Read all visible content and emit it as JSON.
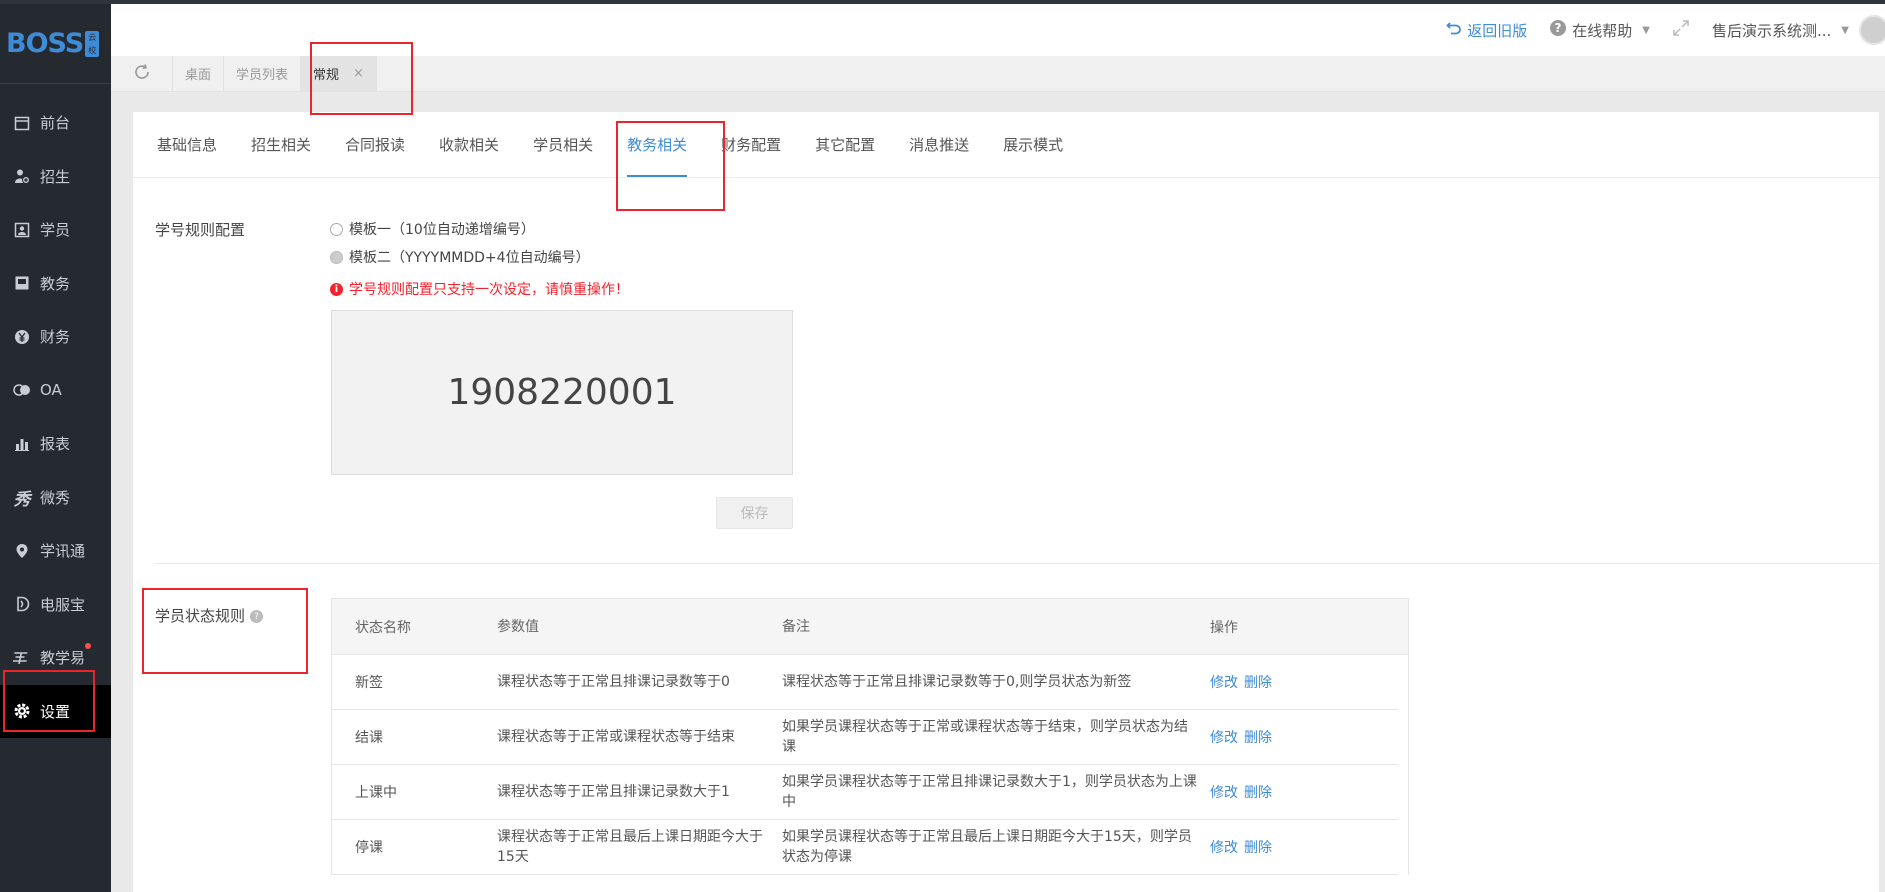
{
  "brand": {
    "logo_text": "BOSS",
    "logo_badge": [
      "云",
      "校"
    ]
  },
  "sidebar": {
    "items": [
      {
        "label": "前台",
        "icon": "calendar-icon"
      },
      {
        "label": "招生",
        "icon": "add-user-icon"
      },
      {
        "label": "学员",
        "icon": "id-card-icon"
      },
      {
        "label": "教务",
        "icon": "book-icon"
      },
      {
        "label": "财务",
        "icon": "yen-icon"
      },
      {
        "label": "OA",
        "icon": "toggle-icon"
      },
      {
        "label": "报表",
        "icon": "bar-chart-icon"
      },
      {
        "label": "微秀",
        "icon": "xiu-icon"
      },
      {
        "label": "学讯通",
        "icon": "location-icon"
      },
      {
        "label": "电服宝",
        "icon": "phone-icon"
      },
      {
        "label": "教学易",
        "icon": "teach-icon"
      },
      {
        "label": "设置",
        "icon": "gear-icon"
      }
    ],
    "active": "设置"
  },
  "header": {
    "back_label": "返回旧版",
    "help_label": "在线帮助",
    "user_label": "售后演示系统测..."
  },
  "tabbar": {
    "tabs": [
      {
        "label": "桌面"
      },
      {
        "label": "学员列表"
      },
      {
        "label": "常规"
      }
    ]
  },
  "subtabs": [
    "基础信息",
    "招生相关",
    "合同报读",
    "收款相关",
    "学员相关",
    "教务相关",
    "财务配置",
    "其它配置",
    "消息推送",
    "展示模式"
  ],
  "active_subtab": "教务相关",
  "student_no": {
    "label": "学号规则配置",
    "option1": "模板一（10位自动递增编号）",
    "option2": "模板二（YYYYMMDD+4位自动编号）",
    "warning": "学号规则配置只支持一次设定，请慎重操作！",
    "preview": "1908220001",
    "save_label": "保存"
  },
  "status_rules": {
    "label": "学员状态规则",
    "columns": [
      "状态名称",
      "参数值",
      "备注",
      "操作"
    ],
    "rows": [
      {
        "name": "新签",
        "param": "课程状态等于正常且排课记录数等于0",
        "note": "课程状态等于正常且排课记录数等于0,则学员状态为新签"
      },
      {
        "name": "结课",
        "param": "课程状态等于正常或课程状态等于结束",
        "note": "如果学员课程状态等于正常或课程状态等于结束，则学员状态为结课"
      },
      {
        "name": "上课中",
        "param": "课程状态等于正常且排课记录数大于1",
        "note": "如果学员课程状态等于正常且排课记录数大于1，则学员状态为上课中"
      },
      {
        "name": "停课",
        "param": "课程状态等于正常且最后上课日期距今大于15天",
        "note": "如果学员课程状态等于正常且最后上课日期距今大于15天，则学员状态为停课"
      }
    ],
    "edit_label": "修改",
    "delete_label": "删除"
  }
}
